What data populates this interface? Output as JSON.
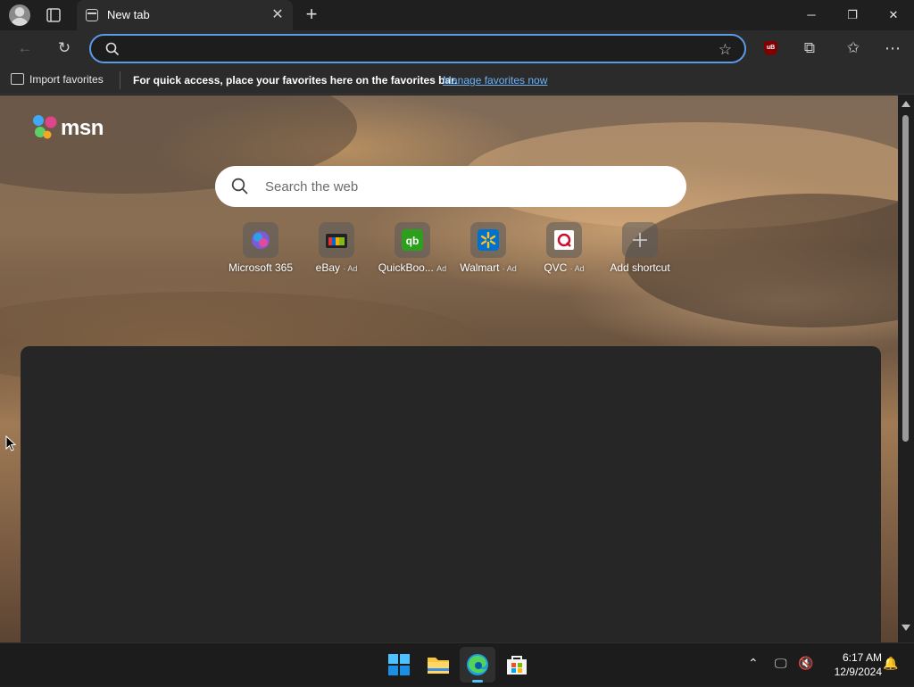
{
  "tab": {
    "title": "New tab"
  },
  "address_bar": {
    "value": "",
    "placeholder": ""
  },
  "favorites_bar": {
    "import_label": "Import favorites",
    "message": "For quick access, place your favorites here on the favorites bar.",
    "manage_link": "Manage favorites now"
  },
  "msn": {
    "logo_text": "msn",
    "search_placeholder": "Search the web",
    "shortcuts": [
      {
        "label": "Microsoft 365",
        "ad": "",
        "icon": "microsoft365-icon"
      },
      {
        "label": "eBay",
        "ad": "· Ad",
        "icon": "ebay-icon"
      },
      {
        "label": "QuickBoo...",
        "ad": "Ad",
        "icon": "quickbooks-icon"
      },
      {
        "label": "Walmart",
        "ad": "· Ad",
        "icon": "walmart-icon"
      },
      {
        "label": "QVC",
        "ad": "· Ad",
        "icon": "qvc-icon"
      },
      {
        "label": "Add shortcut",
        "ad": "",
        "icon": "plus-icon"
      }
    ]
  },
  "taskbar": {
    "apps": [
      "start-icon",
      "file-explorer-icon",
      "edge-icon",
      "store-icon"
    ],
    "time": "6:17 AM",
    "date": "12/9/2024"
  },
  "colors": {
    "accent": "#5b9ce8",
    "link": "#6cb1f5",
    "taskbar_indicator": "#4fc3f7"
  }
}
